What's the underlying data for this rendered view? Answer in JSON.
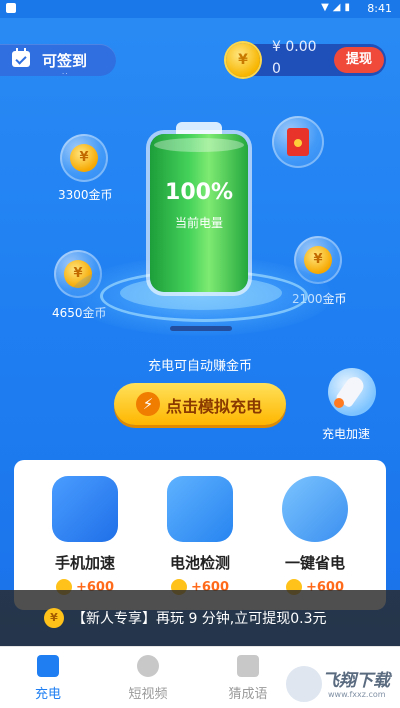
{
  "status_bar": {
    "time": "8:41"
  },
  "checkin": {
    "label": "可签到",
    "dots": "··"
  },
  "wallet": {
    "amount": "¥ 0.00",
    "amount_line2": "0",
    "withdraw_label": "提现",
    "coin_symbol": "¥"
  },
  "bubbles": [
    {
      "label": "3300金币",
      "coin_symbol": "¥"
    },
    {
      "label": "4650金币",
      "coin_symbol": "¥"
    },
    {
      "label": "2100金币",
      "coin_symbol": "¥"
    }
  ],
  "battery": {
    "percent": "100%",
    "sub_label": "当前电量",
    "level": 1.0
  },
  "caption": "充电可自动赚金币",
  "simulate_button": {
    "label": "点击模拟充电",
    "icon": "bolt-icon"
  },
  "rocket_boost": {
    "label": "充电加速"
  },
  "tools": [
    {
      "name": "手机加速",
      "reward": "+600",
      "icon": "rocket-icon"
    },
    {
      "name": "电池检测",
      "reward": "+600",
      "icon": "battery-check-icon"
    },
    {
      "name": "一键省电",
      "reward": "+600",
      "icon": "seedling-icon"
    }
  ],
  "notice": {
    "text": "【新人专享】再玩 9 分钟,立可提现0.3元",
    "coin_symbol": "¥"
  },
  "tabs": [
    {
      "label": "充电",
      "active": true
    },
    {
      "label": "短视频",
      "active": false
    },
    {
      "label": "猜成语",
      "active": false
    }
  ],
  "watermark": {
    "title": "飞翔下载",
    "sub": "www.fxxz.com"
  },
  "colors": {
    "primary": "#1f7ff2",
    "accent_yellow": "#ffc21a",
    "withdraw_red": "#f04a3a",
    "battery_green": "#45d25a"
  }
}
